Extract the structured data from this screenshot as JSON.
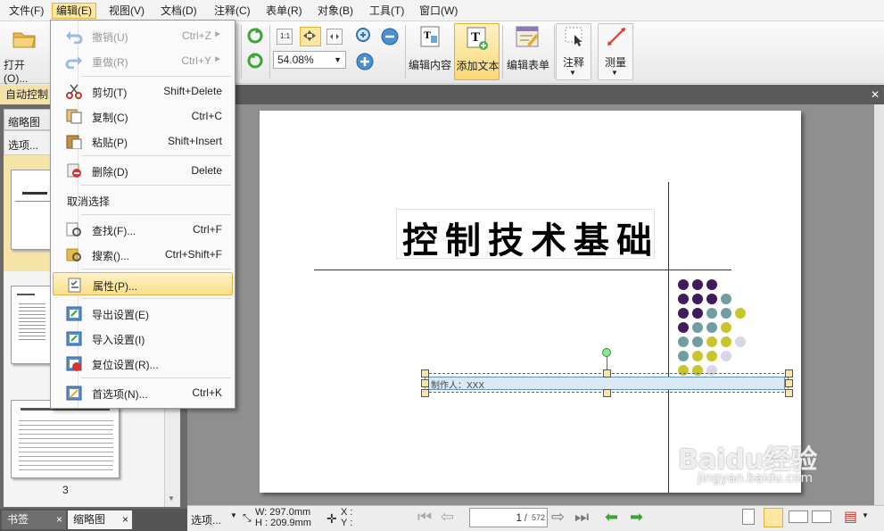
{
  "menubar": {
    "items": [
      "文件(F)",
      "编辑(E)",
      "视图(V)",
      "文档(D)",
      "注释(C)",
      "表单(R)",
      "对象(B)",
      "工具(T)",
      "窗口(W)"
    ]
  },
  "toolbar": {
    "open_label": "打开(O)...",
    "zoom_value": "54.08%",
    "edit_content_label": "编辑内容",
    "add_text_label": "添加文本",
    "edit_form_label": "编辑表单",
    "comment_label": "注释",
    "measure_label": "测量"
  },
  "tabs": {
    "auto_control": "自动控制"
  },
  "left_panel": {
    "title": "缩略图",
    "options_label": "选项...",
    "page3_label": "3",
    "tab_bookmarks": "书签",
    "tab_thumbnails": "缩略图",
    "close_x": "×"
  },
  "edit_menu": {
    "items": [
      {
        "label": "撤销(U)",
        "shortcut": "Ctrl+Z",
        "disabled": true
      },
      {
        "label": "重做(R)",
        "shortcut": "Ctrl+Y",
        "disabled": true
      },
      {
        "label": "剪切(T)",
        "shortcut": "Shift+Delete"
      },
      {
        "label": "复制(C)",
        "shortcut": "Ctrl+C"
      },
      {
        "label": "粘贴(P)",
        "shortcut": "Shift+Insert"
      },
      {
        "label": "删除(D)",
        "shortcut": "Delete"
      },
      {
        "label": "取消选择",
        "shortcut": ""
      },
      {
        "label": "查找(F)...",
        "shortcut": "Ctrl+F"
      },
      {
        "label": "搜索()...",
        "shortcut": "Ctrl+Shift+F"
      },
      {
        "label": "属性(P)...",
        "shortcut": ""
      },
      {
        "label": "导出设置(E)",
        "shortcut": ""
      },
      {
        "label": "导入设置(I)",
        "shortcut": ""
      },
      {
        "label": "复位设置(R)...",
        "shortcut": ""
      },
      {
        "label": "首选项(N)...",
        "shortcut": "Ctrl+K"
      }
    ]
  },
  "document": {
    "title": "控制技术基础",
    "author_field": "制作人：XXX"
  },
  "statusbar": {
    "options_label": "选项...",
    "width": "W: 297.0mm",
    "height": "H : 209.9mm",
    "x_label": "X :",
    "y_label": "Y :",
    "page_current": "1",
    "page_total": "572"
  },
  "watermark": {
    "brand": "Baidu经验",
    "url": "jingyan.baidu.com"
  },
  "colors": {
    "purple": "#3f1a5c",
    "teal": "#6f9ea1",
    "olive": "#c7c62a",
    "lavender": "#d9d6ea",
    "highlight": "#fbe6a2"
  }
}
